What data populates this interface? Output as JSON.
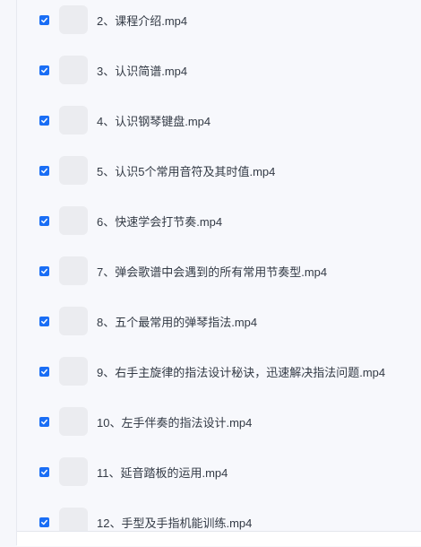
{
  "files": [
    {
      "name": "2、课程介绍.mp4",
      "checked": true
    },
    {
      "name": "3、认识简谱.mp4",
      "checked": true
    },
    {
      "name": "4、认识钢琴键盘.mp4",
      "checked": true
    },
    {
      "name": "5、认识5个常用音符及其时值.mp4",
      "checked": true
    },
    {
      "name": "6、快速学会打节奏.mp4",
      "checked": true
    },
    {
      "name": "7、弹会歌谱中会遇到的所有常用节奏型.mp4",
      "checked": true
    },
    {
      "name": "8、五个最常用的弹琴指法.mp4",
      "checked": true
    },
    {
      "name": "9、右手主旋律的指法设计秘诀，迅速解决指法问题.mp4",
      "checked": true
    },
    {
      "name": "10、左手伴奏的指法设计.mp4",
      "checked": true
    },
    {
      "name": "11、延音踏板的运用.mp4",
      "checked": true
    },
    {
      "name": "12、手型及手指机能训练.mp4",
      "checked": true
    }
  ],
  "colors": {
    "checkbox": "#1a6ef5",
    "thumbnail": "#ebecf0",
    "text": "#333a45"
  }
}
